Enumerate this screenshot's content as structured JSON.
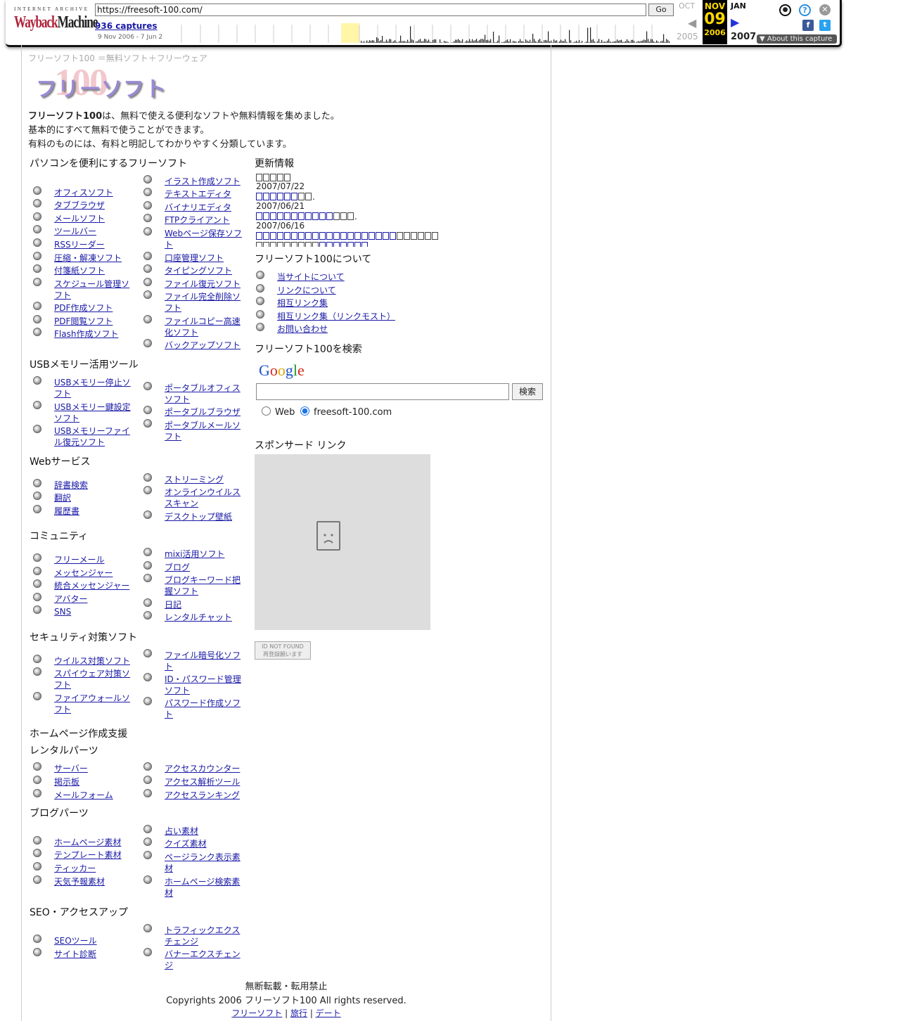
{
  "wayback": {
    "ia_text": "INTERNET ARCHIVE",
    "logo_a": "Wayback",
    "logo_b": "Machine",
    "url": "https://freesoft-100.com/",
    "go": "Go",
    "captures": "936 captures",
    "range": "9 Nov 2006 - 7 Jun 2",
    "prev_month": "OCT",
    "cur_month": "NOV",
    "cur_day": "09",
    "cur_year": "2006",
    "next_month": "JAN",
    "prev_year": "2005",
    "next_year": "2007",
    "about": "About this capture"
  },
  "page": {
    "tagline": "フリーソフト100 ＝無料ソフト＋フリーウェア",
    "logo_name": "フリーソフト",
    "logo_num": "100",
    "intro_bold": "フリーソフト100",
    "intro_1": "は、無料で使える便利なソフトや無料情報を集めました。",
    "intro_2": "基本的にすべて無料で使うことができます。",
    "intro_3": "有料のものには、有料と明記してわかりやすく分類しています。"
  },
  "sections": {
    "pc": "パソコンを便利にするフリーソフト",
    "usb": "USBメモリー活用ツール",
    "web": "Webサービス",
    "community": "コミュニティ",
    "security": "セキュリティ対策ソフト",
    "homepage": "ホームページ作成支援",
    "rental": "レンタルパーツ",
    "blog": "ブログパーツ",
    "seo": "SEO・アクセスアップ",
    "updates": "更新情報",
    "about": "フリーソフト100について",
    "search": "フリーソフト100を検索",
    "sponsored": "スポンサード リンク"
  },
  "pc_left": [
    "オフィスソフト",
    "タブブラウザ",
    "メールソフト",
    "ツールバー",
    "RSSリーダー",
    "圧縮・解凍ソフト",
    "付箋紙ソフト",
    "スケジュール管理ソフト",
    "PDF作成ソフト",
    "PDF閲覧ソフト",
    "Flash作成ソフト"
  ],
  "pc_right": [
    "イラスト作成ソフト",
    "テキストエディタ",
    "バイナリエディタ",
    "FTPクライアント",
    "Webページ保存ソフト",
    "口座管理ソフト",
    "タイピングソフト",
    "ファイル復元ソフト",
    "ファイル完全削除ソフト",
    "ファイルコピー高速化ソフト",
    "バックアップソフト"
  ],
  "usb_left": [
    "USBメモリー停止ソフト",
    "USBメモリー鍵設定ソフト",
    "USBメモリーファイル復元ソフト"
  ],
  "usb_right": [
    "ポータブルオフィスソフト",
    "ポータブルブラウザ",
    "ポータブルメールソフト"
  ],
  "web_left": [
    "辞書検索",
    "翻訳",
    "履歴書"
  ],
  "web_right": [
    "ストリーミング",
    "オンラインウイルススキャン",
    "デスクトップ壁紙"
  ],
  "comm_left": [
    "フリーメール",
    "メッセンジャー",
    "統合メッセンジャー",
    "アバター",
    "SNS"
  ],
  "comm_right": [
    "mixi活用ソフト",
    "ブログ",
    "ブログキーワード把握ソフト",
    "日記",
    "レンタルチャット"
  ],
  "sec_left": [
    "ウイルス対策ソフト",
    "スパイウェア対策ソフト",
    "ファイアウォールソフト"
  ],
  "sec_right": [
    "ファイル暗号化ソフト",
    "ID・パスワード管理ソフト",
    "パスワード作成ソフト"
  ],
  "rent_left": [
    "サーバー",
    "掲示板",
    "メールフォーム"
  ],
  "rent_right": [
    "アクセスカウンター",
    "アクセス解析ツール",
    "アクセスランキング"
  ],
  "blog_left": [
    "ホームページ素材",
    "テンプレート素材",
    "ティッカー",
    "天気予報素材"
  ],
  "blog_right": [
    "占い素材",
    "クイズ素材",
    "ページランク表示素材",
    "ホームページ検索素材"
  ],
  "seo_left": [
    "SEOツール",
    "サイト診断"
  ],
  "seo_right": [
    "トラフィックエクスチェンジ",
    "バナーエクスチェンジ"
  ],
  "updates": {
    "d1": "2007/07/22",
    "d2": "2007/06/21",
    "d3": "2007/06/16"
  },
  "about_links": [
    "当サイトについて",
    "リンクについて",
    "相互リンク集",
    "相互リンク集（リンクモスト）",
    "お問い合わせ"
  ],
  "search": {
    "google": "Google",
    "button": "検索",
    "opt_web": "Web",
    "opt_site": "freesoft-100.com"
  },
  "notfound": {
    "l1": "ID NOT FOUND",
    "l2": "再登録願います"
  },
  "footer": {
    "notice": "無断転載・転用禁止",
    "copyright": "Copyrights 2006 フリーソフト100 All rights reserved.",
    "links": [
      "フリーソフト",
      "旅行",
      "デート"
    ]
  },
  "colors": {
    "link": "#1a1aa6",
    "wayback_red": "#b0233a",
    "current_cap": "#ffd800"
  }
}
